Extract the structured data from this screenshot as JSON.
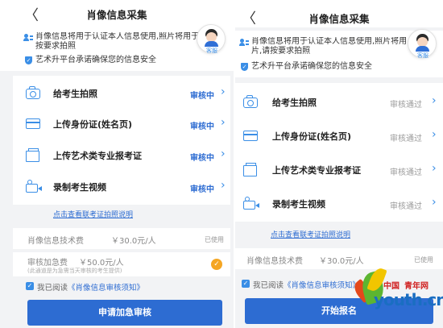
{
  "left": {
    "title": "肖像信息采集",
    "back_glyph": "〈",
    "notice_line1": "肖像信息将用于认证本人信息使用,照片将用于准",
    "notice_line2": "按要求拍照",
    "notice_secure": "艺术升平台承诺确保您的信息安全",
    "cs_label": "客服",
    "items": [
      {
        "label": "给考生拍照",
        "status": "审核中",
        "icon": "camera-icon"
      },
      {
        "label": "上传身份证(姓名页)",
        "status": "审核中",
        "icon": "id-card-icon"
      },
      {
        "label": "上传艺术类专业报考证",
        "status": "审核中",
        "icon": "certificate-icon"
      },
      {
        "label": "录制考生视频",
        "status": "审核中",
        "icon": "video-icon"
      }
    ],
    "link": "点击查看联考证拍照说明",
    "fee_label": "肖像信息技术费",
    "fee_value": "￥30.0元/人",
    "fee_status": "已使用",
    "express_label": "审核加急费",
    "express_value": "￥50.0元/人",
    "express_note": "(此通道是为急需当天审核的考生提供)",
    "agree_prefix": "我已阅读",
    "agree_link": "《肖像信息审核须知》",
    "button": "申请加急审核"
  },
  "right": {
    "title": "肖像信息采集",
    "back_glyph": "〈",
    "notice_line1": "肖像信息将用于认证本人信息使用,照片将用",
    "notice_line2": "片,请按要求拍照",
    "notice_secure": "艺术升平台承诺确保您的信息安全",
    "cs_label": "客服",
    "items": [
      {
        "label": "给考生拍照",
        "status": "审核通过",
        "icon": "camera-icon"
      },
      {
        "label": "上传身份证(姓名页)",
        "status": "审核通过",
        "icon": "id-card-icon"
      },
      {
        "label": "上传艺术类专业报考证",
        "status": "审核通过",
        "icon": "certificate-icon"
      },
      {
        "label": "录制考生视频",
        "status": "审核通过",
        "icon": "video-icon"
      }
    ],
    "link": "点击查看联考证拍照说明",
    "fee_label": "肖像信息技术费",
    "fee_value": "￥30.0元/人",
    "fee_status": "已使用",
    "agree_prefix": "我已阅读",
    "agree_link": "《肖像信息审核须知》",
    "button": "开始报名"
  },
  "watermark": {
    "cn": "中国",
    "brand": "青年网",
    "domain": "youth.cn"
  },
  "colors": {
    "accent": "#2d6cd2",
    "icon_blue": "#3a8ee6",
    "passed_gray": "#9b9b9b",
    "express_check": "#f5a623",
    "background": "#f2f3f5"
  }
}
